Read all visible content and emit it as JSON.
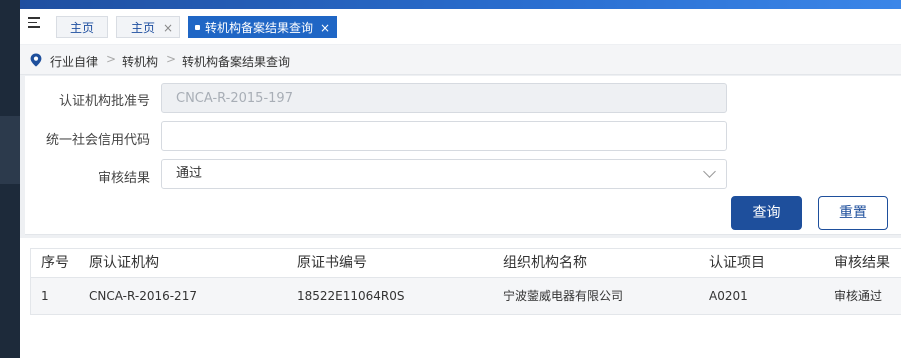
{
  "tabs": [
    {
      "label": "主页",
      "closable": false,
      "active": false
    },
    {
      "label": "主页",
      "closable": true,
      "active": false
    },
    {
      "label": "转机构备案结果查询",
      "closable": true,
      "active": true
    }
  ],
  "tab_close_glyph": "×",
  "breadcrumb": {
    "items": [
      "行业自律",
      "转机构",
      "转机构备案结果查询"
    ],
    "separator": ">"
  },
  "form": {
    "fields": [
      {
        "label": "认证机构批准号",
        "value": "CNCA-R-2015-197",
        "disabled": true
      },
      {
        "label": "统一社会信用代码",
        "value": "",
        "disabled": false
      },
      {
        "label": "审核结果",
        "value": "通过",
        "type": "select"
      }
    ],
    "query_label": "查询",
    "reset_label": "重置"
  },
  "table": {
    "headers": [
      "序号",
      "原认证机构",
      "原证书编号",
      "组织机构名称",
      "认证项目",
      "审核结果"
    ],
    "rows": [
      [
        "1",
        "CNCA-R-2016-217",
        "18522E11064R0S",
        "宁波蓥威电器有限公司",
        "A0201",
        "审核通过"
      ]
    ]
  },
  "colors": {
    "primary": "#1e4f9c",
    "active_tab": "#1f66c5",
    "sidebar": "#1d2a3a"
  }
}
